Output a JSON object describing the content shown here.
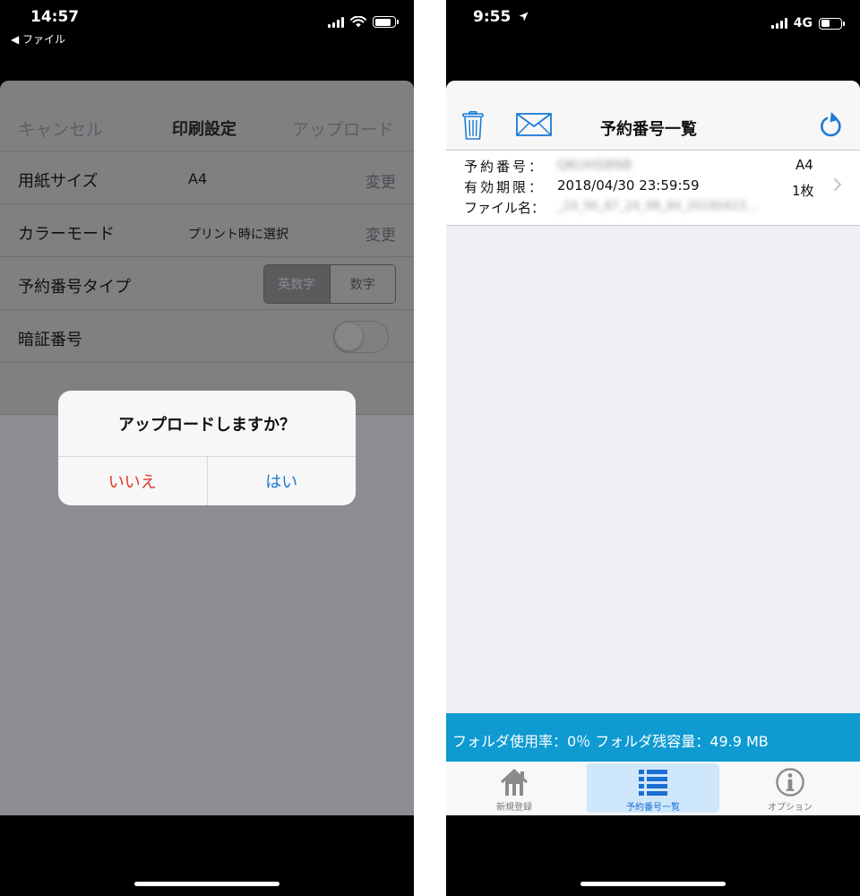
{
  "left_phone": {
    "status": {
      "time": "14:57",
      "back_label": "◀ ファイル"
    },
    "nav": {
      "cancel": "キャンセル",
      "title": "印刷設定",
      "upload": "アップロード"
    },
    "rows": {
      "paper_size": {
        "label": "用紙サイズ",
        "value": "A4",
        "change": "変更"
      },
      "color_mode": {
        "label": "カラーモード",
        "value": "プリント時に選択",
        "change": "変更"
      },
      "number_type": {
        "label": "予約番号タイプ",
        "option_alnum": "英数字",
        "option_num": "数字",
        "selected": "英数字"
      },
      "pin": {
        "label": "暗証番号",
        "enabled": false
      }
    },
    "alert": {
      "title": "アップロードしますか？",
      "no": "いいえ",
      "yes": "はい"
    }
  },
  "right_phone": {
    "status": {
      "time": "9:55",
      "network": "4G"
    },
    "nav": {
      "title": "予約番号一覧",
      "icons": [
        "trash-icon",
        "mail-icon",
        "refresh-icon"
      ]
    },
    "reservation": {
      "number_label": "予約番号：",
      "number_value": "QKUHS8N8",
      "expiry_label": "有効期限：",
      "expiry_value": "2018/04/30 23:59:59",
      "file_label": "ファイル名：",
      "file_value": "_24_96_87_24_98_84_20180423…",
      "paper": "A4",
      "pages": "1枚"
    },
    "folder_status": "フォルダ使用率：0％  フォルダ残容量：49.9 MB",
    "tabs": [
      {
        "label": "新規登録",
        "icon": "home-icon",
        "selected": false
      },
      {
        "label": "予約番号一覧",
        "icon": "list-icon",
        "selected": true
      },
      {
        "label": "オプション",
        "icon": "info-icon",
        "selected": false
      }
    ],
    "colors": {
      "accent": "#1a7bd6",
      "folder_bar": "#0f9ad2",
      "tab_selected_bg": "#cfe7fb"
    }
  }
}
